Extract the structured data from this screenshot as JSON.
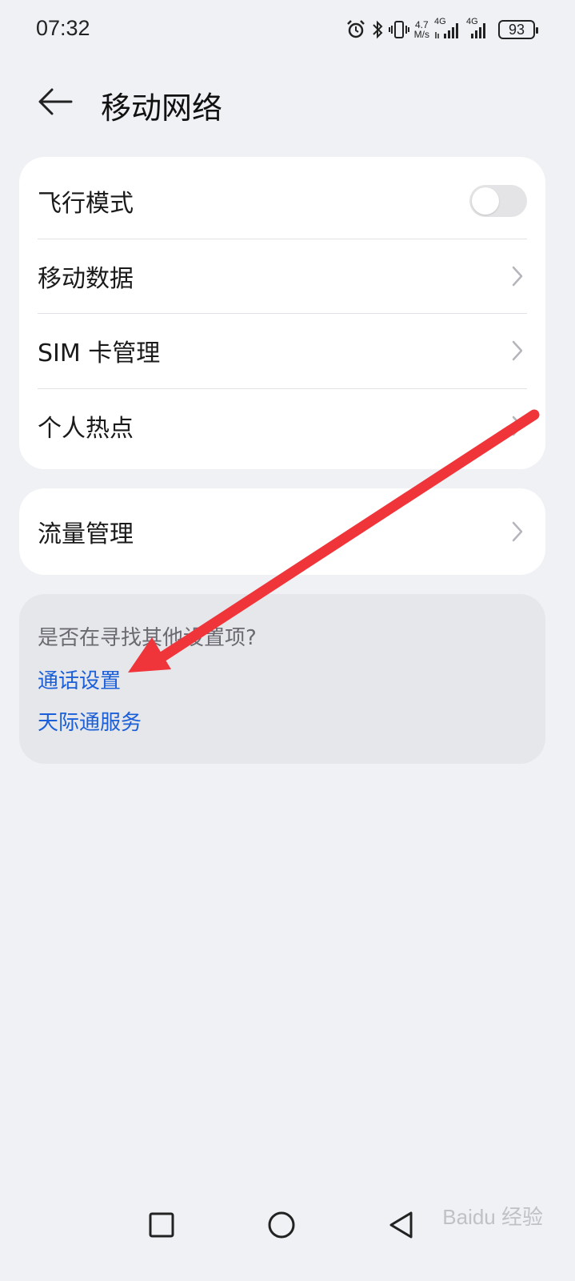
{
  "status_bar": {
    "time": "07:32",
    "net_speed_value": "4.7",
    "net_speed_unit": "M/s",
    "sim1_label": "4G",
    "sim2_label": "4G",
    "battery": "93"
  },
  "header": {
    "title": "移动网络"
  },
  "main_card": {
    "items": [
      {
        "label": "飞行模式",
        "control": "toggle",
        "enabled": false
      },
      {
        "label": "移动数据",
        "control": "chevron"
      },
      {
        "label": "SIM 卡管理",
        "control": "chevron"
      },
      {
        "label": "个人热点",
        "control": "chevron"
      }
    ]
  },
  "traffic_card": {
    "label": "流量管理"
  },
  "suggestions": {
    "title": "是否在寻找其他设置项?",
    "links": [
      "通话设置",
      "天际通服务"
    ]
  },
  "watermark": "Baidu 经验",
  "colors": {
    "background": "#f0f1f5",
    "card": "#ffffff",
    "link": "#1b5fd9",
    "annotation_arrow": "#f0353a"
  },
  "icons": [
    "back-arrow-icon",
    "alarm-icon",
    "bluetooth-icon",
    "vibrate-icon",
    "signal-icon",
    "battery-icon",
    "chevron-right-icon",
    "square-nav-icon",
    "circle-nav-icon",
    "triangle-nav-icon"
  ]
}
